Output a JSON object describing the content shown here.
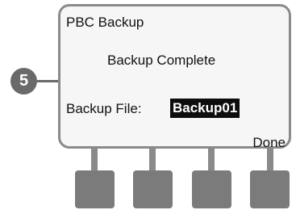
{
  "callout": {
    "number": "5"
  },
  "screen": {
    "title": "PBC Backup",
    "message": "Backup Complete",
    "file_label": "Backup File:",
    "file_value": "Backup01",
    "softkey_label": "Done"
  },
  "buttons": [
    {
      "name": "softkey-1"
    },
    {
      "name": "softkey-2"
    },
    {
      "name": "softkey-3"
    },
    {
      "name": "softkey-4"
    }
  ]
}
